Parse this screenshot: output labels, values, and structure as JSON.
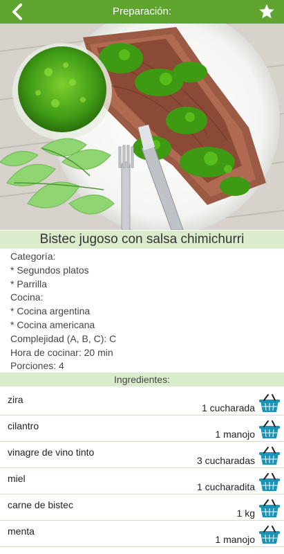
{
  "header": {
    "title": "Preparación:",
    "back_icon": "chevron-left-icon",
    "favorite_icon": "star-icon"
  },
  "recipe": {
    "title": "Bistec jugoso con salsa chimichurri"
  },
  "info": {
    "lines": [
      "Categoría:",
      "* Segundos platos",
      "* Parrilla",
      "Cocina:",
      "* Cocina argentina",
      "* Cocina americana",
      "Complejidad (A, B, C): C",
      "Hora de cocinar: 20 min",
      "Porciones: 4"
    ]
  },
  "ingredients": {
    "header": "Ingredientes:",
    "basket_icon": "shopping-basket-icon",
    "items": [
      {
        "name": "zira",
        "qty": "1 cucharada"
      },
      {
        "name": "cilantro",
        "qty": "1 manojo"
      },
      {
        "name": "vinagre de vino tinto",
        "qty": "3 cucharadas"
      },
      {
        "name": "miel",
        "qty": "1 cucharadita"
      },
      {
        "name": "carne de bistec",
        "qty": "1 kg"
      },
      {
        "name": "menta",
        "qty": "1 manojo"
      }
    ]
  },
  "colors": {
    "topbar": "#5fa42e",
    "section_bg": "#dbeccd",
    "basket": "#1a93b5"
  }
}
